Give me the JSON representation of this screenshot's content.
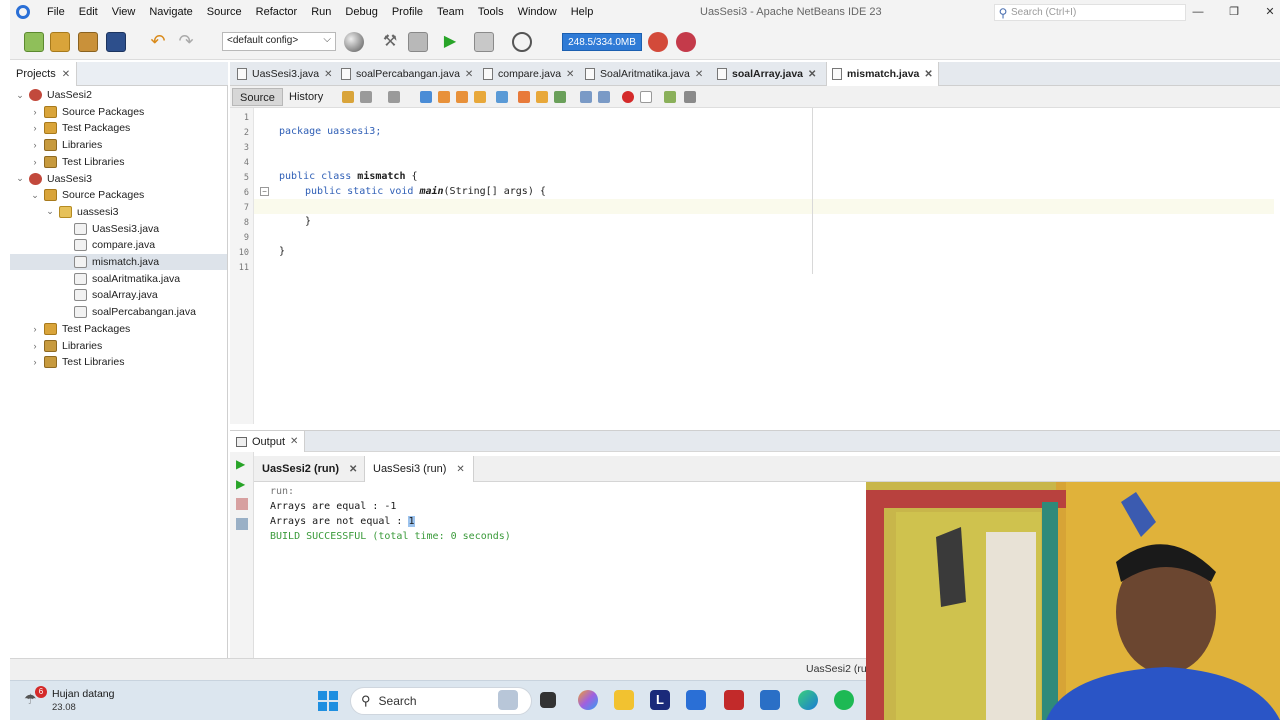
{
  "window": {
    "title": "UasSesi3 - Apache NetBeans IDE 23",
    "search_placeholder": "Search (Ctrl+I)",
    "controls": {
      "minimize": "—",
      "restore": "❐",
      "close": "✕"
    }
  },
  "menu": [
    "File",
    "Edit",
    "View",
    "Navigate",
    "Source",
    "Refactor",
    "Run",
    "Debug",
    "Profile",
    "Team",
    "Tools",
    "Window",
    "Help"
  ],
  "toolbar": {
    "config_value": "<default config>",
    "memory": "248.5/334.0MB"
  },
  "projects": {
    "tab_label": "Projects",
    "tree": [
      {
        "label": "UasSesi2",
        "depth": 0,
        "expanded": true,
        "icon": "project-icon"
      },
      {
        "label": "Source Packages",
        "depth": 1,
        "expanded": false,
        "icon": "source-packages-icon"
      },
      {
        "label": "Test Packages",
        "depth": 1,
        "expanded": false,
        "icon": "test-packages-icon"
      },
      {
        "label": "Libraries",
        "depth": 1,
        "expanded": false,
        "icon": "libraries-icon"
      },
      {
        "label": "Test Libraries",
        "depth": 1,
        "expanded": false,
        "icon": "test-libraries-icon"
      },
      {
        "label": "UasSesi3",
        "depth": 0,
        "expanded": true,
        "icon": "project-icon"
      },
      {
        "label": "Source Packages",
        "depth": 1,
        "expanded": true,
        "icon": "source-packages-icon"
      },
      {
        "label": "uassesi3",
        "depth": 2,
        "expanded": true,
        "icon": "package-icon"
      },
      {
        "label": "UasSesi3.java",
        "depth": 3,
        "icon": "java-file-icon"
      },
      {
        "label": "compare.java",
        "depth": 3,
        "icon": "java-file-icon"
      },
      {
        "label": "mismatch.java",
        "depth": 3,
        "icon": "java-file-icon",
        "selected": true
      },
      {
        "label": "soalAritmatika.java",
        "depth": 3,
        "icon": "java-file-icon"
      },
      {
        "label": "soalArray.java",
        "depth": 3,
        "icon": "java-file-icon"
      },
      {
        "label": "soalPercabangan.java",
        "depth": 3,
        "icon": "java-file-icon"
      },
      {
        "label": "Test Packages",
        "depth": 1,
        "expanded": false,
        "icon": "test-packages-icon"
      },
      {
        "label": "Libraries",
        "depth": 1,
        "expanded": false,
        "icon": "libraries-icon"
      },
      {
        "label": "Test Libraries",
        "depth": 1,
        "expanded": false,
        "icon": "test-libraries-icon"
      }
    ]
  },
  "editor": {
    "tabs": [
      {
        "label": "UasSesi3.java",
        "bold": false,
        "active": false
      },
      {
        "label": "soalPercabangan.java",
        "bold": false,
        "active": false
      },
      {
        "label": "compare.java",
        "bold": false,
        "active": false
      },
      {
        "label": "SoalAritmatika.java",
        "bold": false,
        "active": false
      },
      {
        "label": "soalArray.java",
        "bold": true,
        "active": false
      },
      {
        "label": "mismatch.java",
        "bold": true,
        "active": true
      }
    ],
    "source_label": "Source",
    "history_label": "History",
    "line_numbers": [
      "1",
      "2",
      "3",
      "4",
      "5",
      "6",
      "7",
      "8",
      "9",
      "10",
      "11"
    ],
    "code": {
      "line2": "package uassesi3;",
      "line5_kw1": "public",
      "line5_kw2": "class",
      "line5_name": "mismatch",
      "line5_rest": " {",
      "line6_kw1": "public",
      "line6_kw2": "static",
      "line6_kw3": "void",
      "line6_name": "main",
      "line6_rest": "(String[] args) {",
      "line8": "}",
      "line10": "}"
    }
  },
  "output": {
    "tab_label": "Output",
    "run_tabs": [
      {
        "label": "UasSesi2 (run)",
        "active": false
      },
      {
        "label": "UasSesi3 (run)",
        "active": true
      }
    ],
    "lines": {
      "run": "run:",
      "equal": "Arrays are equal : -1",
      "not_equal_prefix": "Arrays are not equal : ",
      "not_equal_value": "1",
      "build": "BUILD SUCCESSFUL (total time: 0 seconds)"
    }
  },
  "status": {
    "run_label": "UasSesi2 (ru"
  },
  "taskbar": {
    "weather_title": "Hujan datang",
    "weather_time": "23.08",
    "notification_count": "6",
    "search_label": "Search"
  },
  "colors": {
    "accent": "#2f7bd6",
    "keyword": "#2f5fb6",
    "success": "#3a9a3a",
    "selection": "#9cc3ee"
  }
}
